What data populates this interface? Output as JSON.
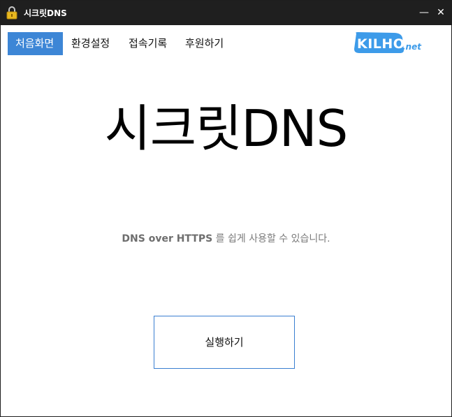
{
  "window": {
    "title": "시크릿DNS",
    "minimize_glyph": "—",
    "close_glyph": "✕"
  },
  "nav": {
    "items": [
      {
        "label": "처음화면",
        "active": true
      },
      {
        "label": "환경설정",
        "active": false
      },
      {
        "label": "접속기록",
        "active": false
      },
      {
        "label": "후원하기",
        "active": false
      }
    ]
  },
  "logo": {
    "text_main": "KILHO",
    "text_suffix": ".net",
    "color": "#3d9be9"
  },
  "hero": {
    "title": "시크릿DNS"
  },
  "subtitle": {
    "strong": "DNS over HTTPS",
    "rest": " 를 쉽게 사용할 수 있습니다."
  },
  "run_button": {
    "label": "실행하기"
  },
  "colors": {
    "titlebar": "#1f1f1f",
    "accent": "#3d86d6",
    "button_border": "#3a7fd1"
  },
  "icons": {
    "app": "lock-icon"
  }
}
